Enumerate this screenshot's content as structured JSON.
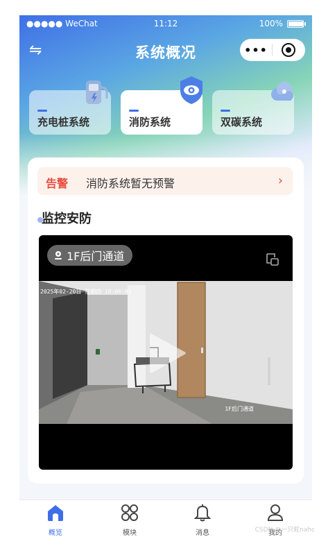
{
  "status_bar": {
    "carrier": "●●●●● WeChat",
    "time": "11:12",
    "battery": "100%",
    "battery_level": 1.0
  },
  "nav": {
    "back_icon": "swap-icon",
    "title": "系统概况",
    "more_icon": "more-dots-icon",
    "close_icon": "target-icon"
  },
  "systems": [
    {
      "label": "充电桩系统",
      "icon": "charging-pile-icon",
      "active": false
    },
    {
      "label": "消防系统",
      "icon": "fire-eye-icon",
      "active": true
    },
    {
      "label": "双碳系统",
      "icon": "cloud-carbon-icon",
      "active": false
    }
  ],
  "alert": {
    "tag": "告警",
    "text": "消防系统暂无预警",
    "chevron": "›"
  },
  "section": {
    "title": "监控安防"
  },
  "camera": {
    "label": "1F后门通道",
    "overlay_timestamp": "2025年02-20日 星期四 10:06:01",
    "overlay_name": "1F后门通道",
    "play_icon": "play-icon",
    "expand_icon": "expand-icon"
  },
  "tabbar": {
    "items": [
      {
        "label": "概览",
        "icon": "home-icon",
        "active": true
      },
      {
        "label": "模块",
        "icon": "modules-icon",
        "active": false
      },
      {
        "label": "消息",
        "icon": "bell-icon",
        "active": false
      },
      {
        "label": "我的",
        "icon": "user-icon",
        "active": false
      }
    ]
  },
  "watermark": "CSDN @一只蛇nahc",
  "colors": {
    "accent": "#3e6ee8",
    "alert": "#e84d3d",
    "alert_bg": "#fdf1ec"
  }
}
